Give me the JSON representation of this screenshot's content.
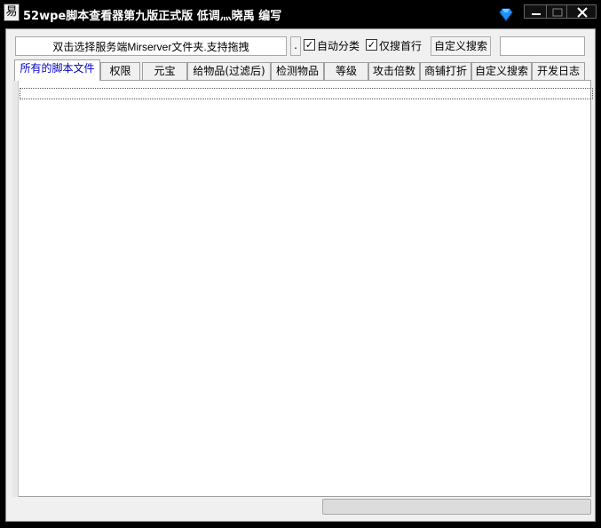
{
  "window": {
    "title": "52wpe脚本查看器第九版正式版  低调灬晓禹 编写",
    "app_icon_glyph": "易",
    "icons": {
      "app": "app-icon",
      "gem": "gem-icon",
      "minimize": "minimize-icon",
      "maximize": "maximize-icon",
      "close": "close-icon"
    },
    "controls": {
      "minimize": "—",
      "maximize": "□",
      "close": "✕"
    },
    "accent": "#1e90ff"
  },
  "toolbar": {
    "path_input_value": "双击选择服务端Mirserver文件夹.支持拖拽",
    "browse_label": ".",
    "auto_classify_label": "自动分类",
    "auto_classify_checked": "✓",
    "first_line_only_label": "仅搜首行",
    "first_line_only_checked": "✓",
    "custom_search_label": "自定义搜索",
    "custom_search_value": ""
  },
  "tabs": [
    {
      "label": "所有的脚本文件"
    },
    {
      "label": "权限"
    },
    {
      "label": "元宝"
    },
    {
      "label": "给物品(过滤后)"
    },
    {
      "label": "检测物品"
    },
    {
      "label": "等级"
    },
    {
      "label": "攻击倍数"
    },
    {
      "label": "商铺打折"
    },
    {
      "label": "自定义搜索"
    },
    {
      "label": "开发日志"
    }
  ]
}
